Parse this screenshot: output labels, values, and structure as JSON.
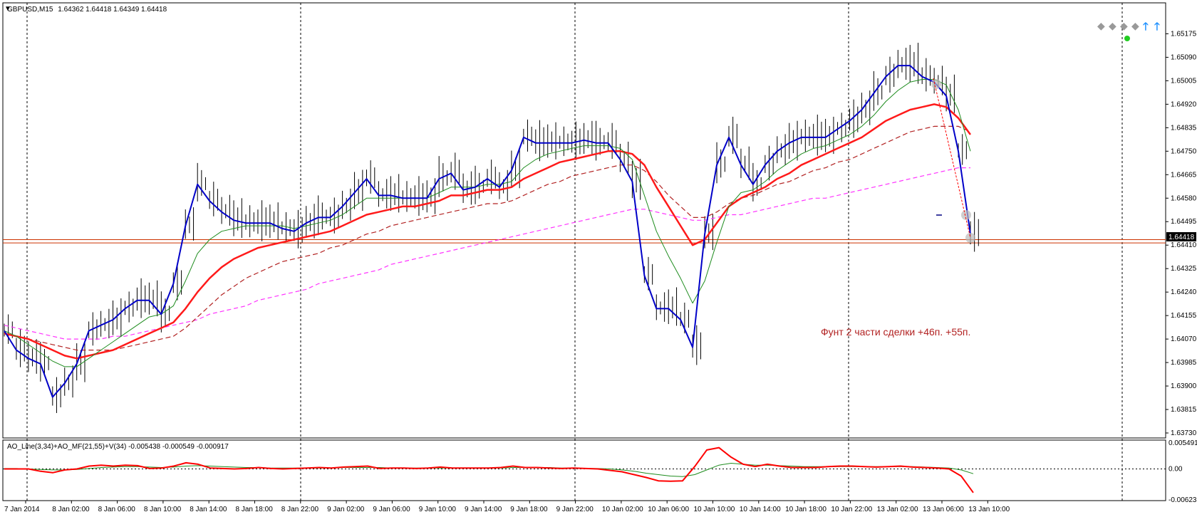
{
  "window": {
    "symbol_title": "GBPUSD,M15",
    "ohlc": "1.64362 1.64418 1.64349 1.64418"
  },
  "annotation": "Фунт 2 части сделки +46п. +55п.",
  "indicator": {
    "title": "AO_Line(3,34)+AO_MF(21,55)+V(34) -0.005438 -0.000549 -0.000917",
    "ticks": [
      "0.005491",
      "0.00",
      "-0.006236"
    ]
  },
  "current_price_label": "1.64418",
  "colors": {
    "price": "#0000c8",
    "ema_fast": "#1e8c1e",
    "ema_mid": "#ff1a1a",
    "ema_slow": "#b22222",
    "ema_long": "#ff33ff",
    "level_line": "#cc3300",
    "osc_main": "#ff0000",
    "osc_signal": "#1e8c1e",
    "note": "#b22222"
  },
  "chart_data": {
    "type": "line",
    "price_ylim": [
      1.6373,
      1.6522
    ],
    "y_ticks": [
      "1.65175",
      "1.65090",
      "1.65005",
      "1.64920",
      "1.64835",
      "1.64750",
      "1.64665",
      "1.64580",
      "1.64495",
      "1.64410",
      "1.64325",
      "1.64240",
      "1.64155",
      "1.64070",
      "1.63985",
      "1.63900",
      "1.63815",
      "1.63730"
    ],
    "x_labels": [
      "7 Jan 2014",
      "8 Jan 02:00",
      "8 Jan 06:00",
      "8 Jan 10:00",
      "8 Jan 14:00",
      "8 Jan 18:00",
      "8 Jan 22:00",
      "9 Jan 02:00",
      "9 Jan 06:00",
      "9 Jan 10:00",
      "9 Jan 14:00",
      "9 Jan 18:00",
      "9 Jan 22:00",
      "10 Jan 02:00",
      "10 Jan 06:00",
      "10 Jan 10:00",
      "10 Jan 14:00",
      "10 Jan 18:00",
      "10 Jan 22:00",
      "13 Jan 02:00",
      "13 Jan 06:00",
      "13 Jan 10:00"
    ],
    "level_lines": [
      1.64418,
      1.6443
    ],
    "series": [
      {
        "key": "price",
        "values": [
          1.641,
          1.6403,
          1.64,
          1.6398,
          1.6386,
          1.6391,
          1.6398,
          1.641,
          1.6412,
          1.6414,
          1.6418,
          1.6421,
          1.6421,
          1.6416,
          1.6427,
          1.6448,
          1.6463,
          1.6457,
          1.6453,
          1.645,
          1.6449,
          1.6449,
          1.6449,
          1.6447,
          1.6446,
          1.6449,
          1.6451,
          1.6451,
          1.6455,
          1.646,
          1.6465,
          1.6459,
          1.6459,
          1.6458,
          1.6458,
          1.6458,
          1.6465,
          1.6467,
          1.6461,
          1.6462,
          1.6465,
          1.6462,
          1.6468,
          1.648,
          1.6478,
          1.6478,
          1.6478,
          1.6478,
          1.6479,
          1.6478,
          1.6478,
          1.6472,
          1.6464,
          1.643,
          1.6418,
          1.6418,
          1.6414,
          1.6404,
          1.6445,
          1.647,
          1.648,
          1.647,
          1.6463,
          1.647,
          1.6475,
          1.6478,
          1.648,
          1.648,
          1.648,
          1.6483,
          1.6486,
          1.649,
          1.6496,
          1.6502,
          1.6506,
          1.6506,
          1.6502,
          1.65,
          1.6495,
          1.6475,
          1.6445
        ]
      },
      {
        "key": "ema_fast",
        "values": [
          1.641,
          1.6408,
          1.6405,
          1.6402,
          1.6399,
          1.6397,
          1.6397,
          1.64,
          1.6403,
          1.6406,
          1.6409,
          1.6412,
          1.6415,
          1.6416,
          1.6419,
          1.6428,
          1.6438,
          1.6443,
          1.6446,
          1.6447,
          1.6448,
          1.6448,
          1.6448,
          1.6448,
          1.6447,
          1.6448,
          1.6449,
          1.645,
          1.6452,
          1.6455,
          1.6458,
          1.6458,
          1.6458,
          1.6458,
          1.6458,
          1.6458,
          1.646,
          1.6462,
          1.6462,
          1.6462,
          1.6463,
          1.6463,
          1.6464,
          1.6469,
          1.6472,
          1.6474,
          1.6475,
          1.6476,
          1.6477,
          1.6477,
          1.6477,
          1.6476,
          1.6472,
          1.6459,
          1.6446,
          1.6437,
          1.6429,
          1.642,
          1.6428,
          1.6442,
          1.6455,
          1.646,
          1.6461,
          1.6464,
          1.6468,
          1.6471,
          1.6474,
          1.6476,
          1.6477,
          1.6479,
          1.6481,
          1.6484,
          1.6488,
          1.6493,
          1.6497,
          1.65,
          1.6501,
          1.6501,
          1.6499,
          1.649,
          1.6475
        ]
      },
      {
        "key": "ema_mid",
        "values": [
          1.6409,
          1.6408,
          1.6407,
          1.6405,
          1.6403,
          1.6401,
          1.64,
          1.6401,
          1.6402,
          1.6403,
          1.6405,
          1.6407,
          1.6409,
          1.6411,
          1.6413,
          1.6418,
          1.6424,
          1.6429,
          1.6433,
          1.6436,
          1.6438,
          1.644,
          1.6441,
          1.6442,
          1.6443,
          1.6444,
          1.6445,
          1.6446,
          1.6448,
          1.645,
          1.6452,
          1.6453,
          1.6454,
          1.6455,
          1.6455,
          1.6456,
          1.6457,
          1.6459,
          1.6459,
          1.646,
          1.6461,
          1.6461,
          1.6462,
          1.6465,
          1.6467,
          1.6469,
          1.6471,
          1.6472,
          1.6473,
          1.6474,
          1.6475,
          1.6475,
          1.6474,
          1.647,
          1.6462,
          1.6455,
          1.6448,
          1.6441,
          1.6443,
          1.6449,
          1.6455,
          1.6458,
          1.646,
          1.6462,
          1.6465,
          1.6467,
          1.647,
          1.6472,
          1.6474,
          1.6476,
          1.6478,
          1.648,
          1.6483,
          1.6486,
          1.6488,
          1.649,
          1.6491,
          1.6492,
          1.6491,
          1.6487,
          1.6481
        ]
      },
      {
        "key": "ema_slow",
        "values": [
          1.6409,
          1.6408,
          1.6407,
          1.6406,
          1.6405,
          1.6404,
          1.6403,
          1.6403,
          1.6403,
          1.6403,
          1.6404,
          1.6405,
          1.6406,
          1.6407,
          1.6408,
          1.6411,
          1.6415,
          1.6419,
          1.6423,
          1.6426,
          1.6429,
          1.6431,
          1.6433,
          1.6435,
          1.6436,
          1.6437,
          1.6438,
          1.644,
          1.6441,
          1.6443,
          1.6445,
          1.6446,
          1.6448,
          1.6449,
          1.645,
          1.6451,
          1.6452,
          1.6453,
          1.6454,
          1.6455,
          1.6456,
          1.6456,
          1.6457,
          1.6459,
          1.6461,
          1.6463,
          1.6464,
          1.6466,
          1.6467,
          1.6468,
          1.6469,
          1.647,
          1.647,
          1.6468,
          1.6464,
          1.6459,
          1.6455,
          1.6451,
          1.6451,
          1.6453,
          1.6456,
          1.6458,
          1.6459,
          1.6461,
          1.6463,
          1.6464,
          1.6466,
          1.6468,
          1.6469,
          1.6471,
          1.6472,
          1.6474,
          1.6476,
          1.6478,
          1.648,
          1.6482,
          1.6483,
          1.6484,
          1.6484,
          1.6484,
          1.6482
        ]
      },
      {
        "key": "ema_long",
        "values": [
          1.6412,
          1.6411,
          1.641,
          1.6409,
          1.6408,
          1.6407,
          1.6407,
          1.6407,
          1.6407,
          1.6408,
          1.6408,
          1.6409,
          1.641,
          1.6411,
          1.6412,
          1.6413,
          1.6414,
          1.6416,
          1.6417,
          1.6418,
          1.6419,
          1.6421,
          1.6422,
          1.6423,
          1.6424,
          1.6425,
          1.6427,
          1.6428,
          1.6429,
          1.643,
          1.6431,
          1.6432,
          1.6434,
          1.6435,
          1.6436,
          1.6437,
          1.6438,
          1.6439,
          1.644,
          1.6441,
          1.6442,
          1.6443,
          1.6444,
          1.6445,
          1.6446,
          1.6447,
          1.6448,
          1.6449,
          1.645,
          1.6451,
          1.6452,
          1.6453,
          1.6454,
          1.6454,
          1.6453,
          1.6452,
          1.6451,
          1.645,
          1.645,
          1.6451,
          1.6452,
          1.6452,
          1.6453,
          1.6454,
          1.6455,
          1.6456,
          1.6457,
          1.6458,
          1.6458,
          1.6459,
          1.646,
          1.6461,
          1.6462,
          1.6463,
          1.6464,
          1.6465,
          1.6466,
          1.6467,
          1.6468,
          1.6469,
          1.6469
        ]
      },
      {
        "key": "osc_main",
        "values": [
          0.0,
          0.0,
          0.0,
          -0.0005,
          -0.0008,
          -0.0002,
          0.0,
          0.0006,
          0.0008,
          0.0006,
          0.0008,
          0.0007,
          0.0001,
          0.0002,
          0.0006,
          0.0013,
          0.001,
          0.0002,
          0.0001,
          0.0,
          0.0001,
          0.0003,
          0.0001,
          0.0,
          0.0001,
          0.0002,
          0.0003,
          0.0002,
          0.0004,
          0.0005,
          0.0006,
          0.0001,
          0.0002,
          0.0002,
          0.0001,
          0.0002,
          0.0004,
          0.0002,
          0.0002,
          0.0002,
          0.0002,
          0.0003,
          0.0006,
          0.0003,
          0.0003,
          0.0002,
          0.0001,
          0.0002,
          0.0001,
          0.0,
          -0.0003,
          -0.0006,
          -0.0012,
          -0.0018,
          -0.0025,
          -0.0026,
          -0.0025,
          0.0005,
          0.004,
          0.0045,
          0.0025,
          0.001,
          0.0005,
          0.001,
          0.0006,
          0.0003,
          0.0003,
          0.0003,
          0.0005,
          0.0006,
          0.0006,
          0.0005,
          0.0004,
          0.0005,
          0.0006,
          0.0004,
          0.0003,
          0.0002,
          0.0,
          -0.0015,
          -0.005
        ]
      },
      {
        "key": "osc_signal",
        "values": [
          0.0001,
          0.0001,
          0.0,
          -0.0001,
          -0.0002,
          -0.0002,
          -0.0001,
          0.0001,
          0.0003,
          0.0004,
          0.0005,
          0.0005,
          0.0004,
          0.0003,
          0.0004,
          0.0006,
          0.0007,
          0.0006,
          0.0005,
          0.0004,
          0.0003,
          0.0003,
          0.0002,
          0.0002,
          0.0002,
          0.0002,
          0.0002,
          0.0002,
          0.0003,
          0.0003,
          0.0003,
          0.0003,
          0.0002,
          0.0002,
          0.0002,
          0.0002,
          0.0002,
          0.0002,
          0.0002,
          0.0002,
          0.0002,
          0.0002,
          0.0003,
          0.0003,
          0.0003,
          0.0003,
          0.0002,
          0.0002,
          0.0001,
          0.0001,
          0.0,
          -0.0002,
          -0.0005,
          -0.0009,
          -0.0012,
          -0.0015,
          -0.0016,
          -0.0012,
          -0.0002,
          0.0008,
          0.0012,
          0.001,
          0.0008,
          0.0008,
          0.0007,
          0.0006,
          0.0005,
          0.0005,
          0.0005,
          0.0005,
          0.0005,
          0.0005,
          0.0005,
          0.0005,
          0.0005,
          0.0005,
          0.0004,
          0.0003,
          0.0002,
          -0.0002,
          -0.001
        ]
      }
    ],
    "osc_ylim": [
      -0.006236,
      0.005491
    ]
  }
}
